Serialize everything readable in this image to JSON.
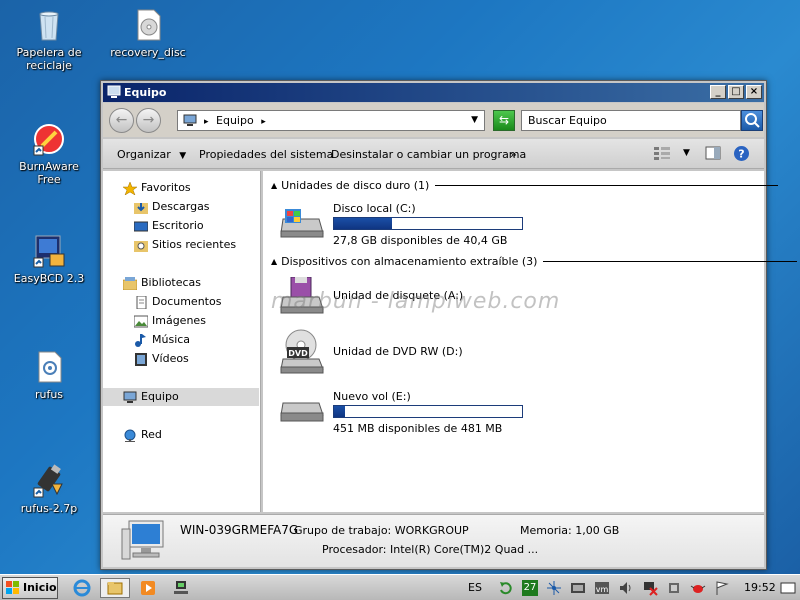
{
  "desktop": {
    "icons": [
      {
        "label": "Papelera de reciclaje",
        "icon": "recycle-bin-icon"
      },
      {
        "label": "recovery_disc",
        "icon": "disc-file-icon"
      },
      {
        "label": "BurnAware Free",
        "icon": "burnaware-icon"
      },
      {
        "label": "EasyBCD 2.3",
        "icon": "easybcd-icon"
      },
      {
        "label": "rufus",
        "icon": "rufus-icon"
      },
      {
        "label": "rufus-2.7p",
        "icon": "usb-drive-icon"
      }
    ]
  },
  "window": {
    "title": "Equipo",
    "address": {
      "location": "Equipo",
      "search_placeholder": "Buscar Equipo"
    },
    "commands": [
      "Organizar",
      "Propiedades del sistema",
      "Desinstalar o cambiar un programa",
      "»"
    ],
    "nav": {
      "favorites": {
        "label": "Favoritos",
        "items": [
          "Descargas",
          "Escritorio",
          "Sitios recientes"
        ]
      },
      "libraries": {
        "label": "Bibliotecas",
        "items": [
          "Documentos",
          "Imágenes",
          "Música",
          "Vídeos"
        ]
      },
      "computer": "Equipo",
      "network": "Red"
    },
    "groups": [
      {
        "title": "Unidades de disco duro (1)",
        "drives": [
          {
            "name": "Disco local (C:)",
            "info": "27,8 GB disponibles de 40,4 GB",
            "used_fraction": 0.31
          }
        ]
      },
      {
        "title": "Dispositivos con almacenamiento extraíble (3)",
        "drives": [
          {
            "name": "Unidad de disquete (A:)",
            "info": ""
          },
          {
            "name": "Unidad de DVD RW (D:)",
            "info": ""
          },
          {
            "name": "Nuevo vol (E:)",
            "info": "451 MB disponibles de 481 MB",
            "used_fraction": 0.06
          }
        ]
      }
    ],
    "watermark": "marbun - lampiweb.com",
    "details": {
      "computer_name": "WIN-039GRMEFA7G",
      "workgroup": "Grupo de trabajo: WORKGROUP",
      "memory": "Memoria: 1,00 GB",
      "processor": "Procesador: Intel(R) Core(TM)2 Quad ..."
    }
  },
  "taskbar": {
    "start_label": "Inicio",
    "language": "ES",
    "clock": "19:52",
    "tray_badge": "27"
  }
}
